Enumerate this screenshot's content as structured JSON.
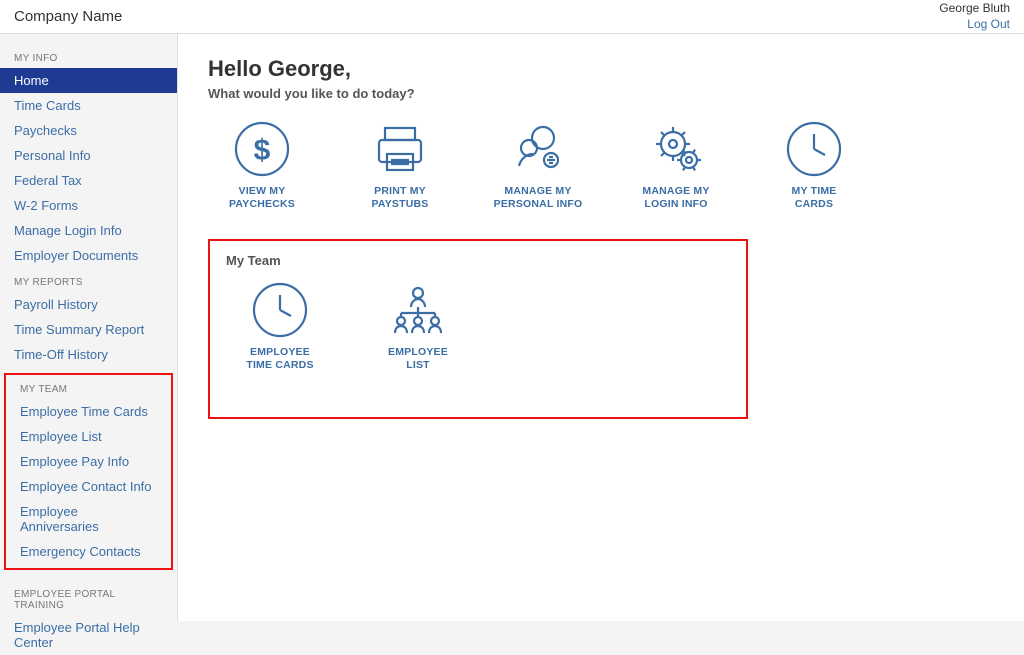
{
  "header": {
    "company": "Company Name",
    "user": "George Bluth",
    "logout": "Log Out"
  },
  "sidebar": {
    "sections": [
      {
        "title": "MY INFO",
        "items": [
          "Home",
          "Time Cards",
          "Paychecks",
          "Personal Info",
          "Federal Tax",
          "W-2 Forms",
          "Manage Login Info",
          "Employer Documents"
        ],
        "activeIndex": 0
      },
      {
        "title": "MY REPORTS",
        "items": [
          "Payroll History",
          "Time Summary Report",
          "Time-Off History"
        ]
      },
      {
        "title": "MY TEAM",
        "items": [
          "Employee Time Cards",
          "Employee List",
          "Employee Pay Info",
          "Employee Contact Info",
          "Employee Anniversaries",
          "Emergency Contacts"
        ],
        "highlight": true
      },
      {
        "title": "EMPLOYEE PORTAL TRAINING",
        "items": [
          "Employee Portal Help Center"
        ]
      }
    ]
  },
  "main": {
    "greeting": "Hello George,",
    "subgreet": "What would you like to do today?",
    "tiles": [
      {
        "label": "VIEW MY\nPAYCHECKS",
        "icon": "dollar"
      },
      {
        "label": "PRINT MY\nPAYSTUBS",
        "icon": "printer"
      },
      {
        "label": "MANAGE MY\nPERSONAL INFO",
        "icon": "people"
      },
      {
        "label": "MANAGE MY\nLOGIN INFO",
        "icon": "gear"
      },
      {
        "label": "MY TIME\nCARDS",
        "icon": "clock"
      }
    ],
    "team": {
      "title": "My Team",
      "tiles": [
        {
          "label": "EMPLOYEE\nTIME CARDS",
          "icon": "clock"
        },
        {
          "label": "EMPLOYEE\nLIST",
          "icon": "org"
        }
      ]
    }
  }
}
